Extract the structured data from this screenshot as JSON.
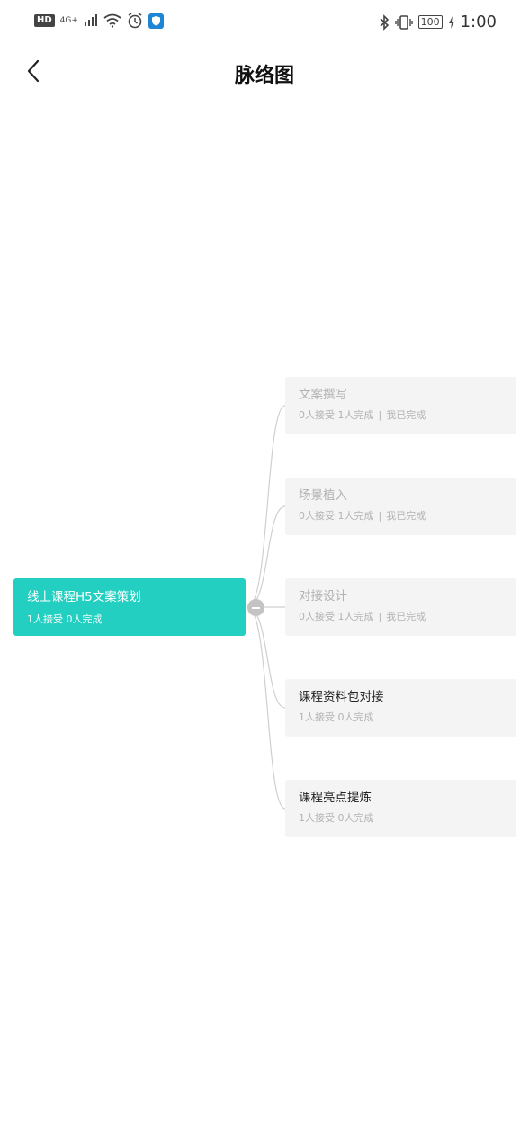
{
  "status_bar": {
    "hd": "HD",
    "network": "4G+",
    "battery": "100",
    "time": "1:00"
  },
  "nav": {
    "title": "脉络图"
  },
  "mindmap": {
    "root": {
      "title": "线上课程H5文案策划",
      "stats": "1人接受 0人完成"
    },
    "children": [
      {
        "title": "文案撰写",
        "stats": "0人接受 1人完成",
        "mine": "我已完成"
      },
      {
        "title": "场景植入",
        "stats": "0人接受 1人完成",
        "mine": "我已完成"
      },
      {
        "title": "对接设计",
        "stats": "0人接受 1人完成",
        "mine": "我已完成"
      },
      {
        "title": "课程资料包对接",
        "stats": "1人接受 0人完成"
      },
      {
        "title": "课程亮点提炼",
        "stats": "1人接受 0人完成"
      }
    ]
  }
}
